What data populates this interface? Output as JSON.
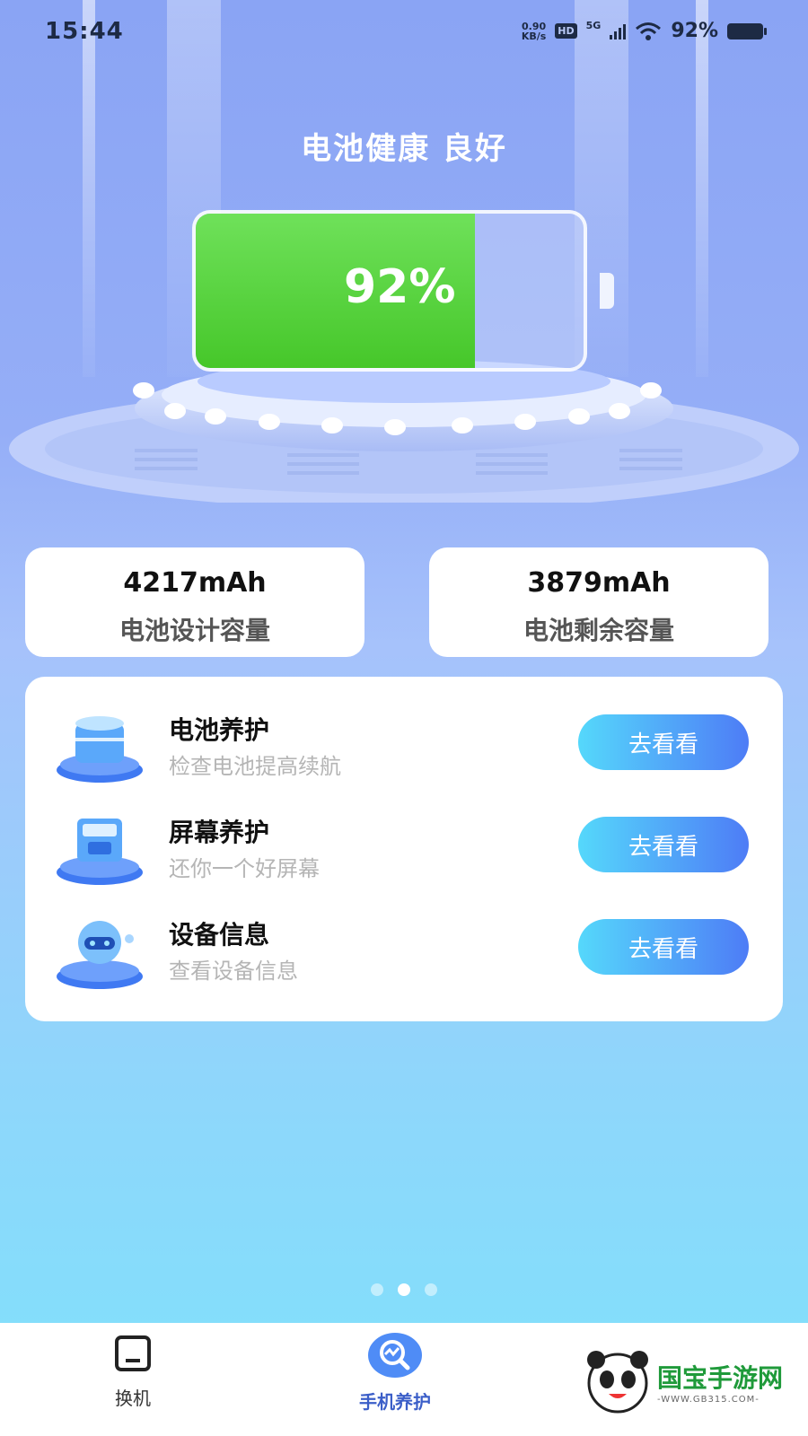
{
  "status_bar": {
    "time": "15:44",
    "speed_value": "0.90",
    "speed_unit": "KB/s",
    "hd_badge": "HD",
    "network": "5G",
    "battery_percent": "92%"
  },
  "header": {
    "health_title": "电池健康 良好"
  },
  "battery": {
    "percent_label": "92%",
    "level": 0.72,
    "fill_color": "#4fd134"
  },
  "capacity_cards": [
    {
      "value": "4217mAh",
      "label": "电池设计容量"
    },
    {
      "value": "3879mAh",
      "label": "电池剩余容量"
    }
  ],
  "functions": [
    {
      "title": "电池养护",
      "subtitle": "检查电池提高续航",
      "button": "去看看",
      "icon": "battery-care-icon"
    },
    {
      "title": "屏幕养护",
      "subtitle": "还你一个好屏幕",
      "button": "去看看",
      "icon": "screen-care-icon"
    },
    {
      "title": "设备信息",
      "subtitle": "查看设备信息",
      "button": "去看看",
      "icon": "device-info-icon"
    }
  ],
  "pager": {
    "count": 3,
    "active_index": 1
  },
  "tabbar": {
    "items": [
      {
        "label": "换机",
        "icon": "phone-switch-icon"
      },
      {
        "label": "手机养护",
        "icon": "phone-care-icon",
        "active": true
      }
    ]
  },
  "watermark": {
    "text": "国宝手游网",
    "sub": "-WWW.GB315.COM-"
  },
  "colors": {
    "accent": "#3b5ec8",
    "button_start": "#55d8fb",
    "button_end": "#4e7cf6"
  }
}
